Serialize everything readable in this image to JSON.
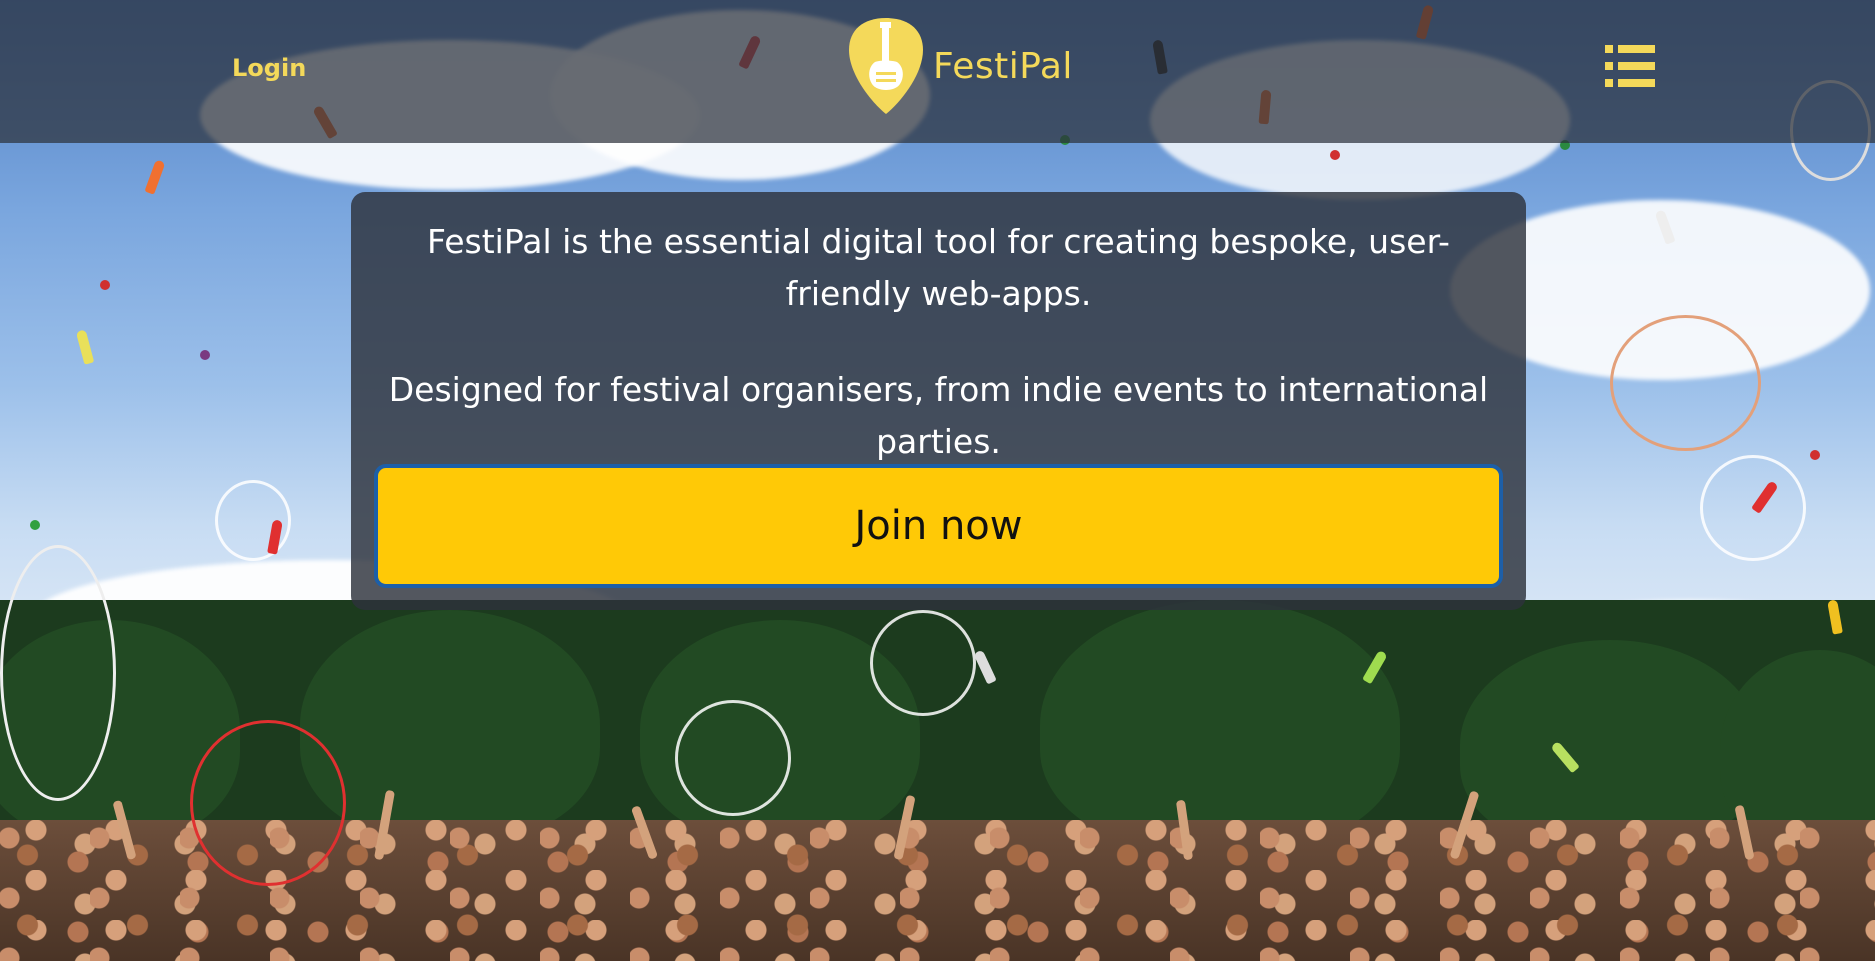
{
  "header": {
    "login_label": "Login",
    "brand_name": "FestiPal",
    "logo_icon": "guitar-pick-logo-icon",
    "menu_icon": "hamburger-list-icon"
  },
  "hero": {
    "line_one": "FestiPal is the essential digital tool for creating bespoke, user-friendly web-apps.",
    "line_two": "Designed for festival organisers, from indie events to international parties.",
    "cta_label": "Join now"
  },
  "background": {
    "image": "festival-crowd-juggling-photo"
  },
  "colors": {
    "accent_yellow": "#ffc906",
    "brand_text": "#f4d95a",
    "button_border": "#1d5fa8",
    "panel_bg": "#2d323c"
  }
}
